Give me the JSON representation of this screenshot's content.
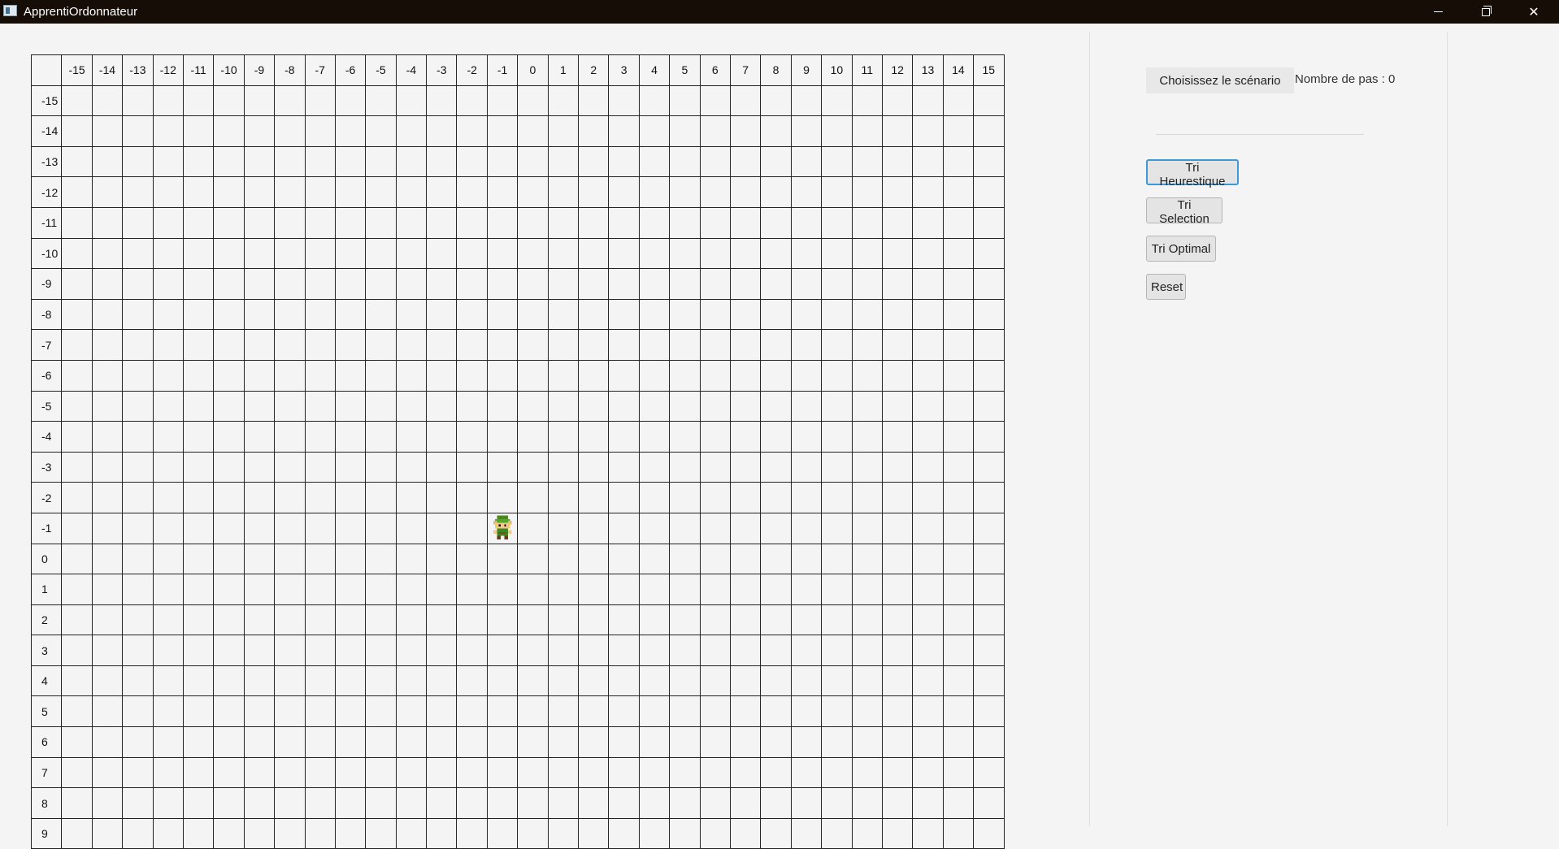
{
  "window": {
    "title": "ApprentiOrdonnateur"
  },
  "grid": {
    "column_labels": [
      "-15",
      "-14",
      "-13",
      "-12",
      "-11",
      "-10",
      "-9",
      "-8",
      "-7",
      "-6",
      "-5",
      "-4",
      "-3",
      "-2",
      "-1",
      "0",
      "1",
      "2",
      "3",
      "4",
      "5",
      "6",
      "7",
      "8",
      "9",
      "10",
      "11",
      "12",
      "13",
      "14",
      "15"
    ],
    "row_labels": [
      "-15",
      "-14",
      "-13",
      "-12",
      "-11",
      "-10",
      "-9",
      "-8",
      "-7",
      "-6",
      "-5",
      "-4",
      "-3",
      "-2",
      "-1",
      "0",
      "1",
      "2",
      "3",
      "4",
      "5",
      "6",
      "7",
      "8",
      "9"
    ],
    "character": {
      "icon": "link-character-icon",
      "column": "-1",
      "row": "-1"
    }
  },
  "controls": {
    "scenario_button": "Choisissez le scénario",
    "steps_label": "Nombre de pas : 0",
    "sort_buttons": [
      {
        "label": "Tri Heurestique",
        "focused": true
      },
      {
        "label": "Tri Selection",
        "focused": false
      },
      {
        "label": "Tri Optimal",
        "focused": false
      }
    ],
    "reset_button": "Reset"
  },
  "colors": {
    "titlebar": "#150d06",
    "focus_border": "#3c9ad8",
    "background": "#f4f4f4"
  }
}
